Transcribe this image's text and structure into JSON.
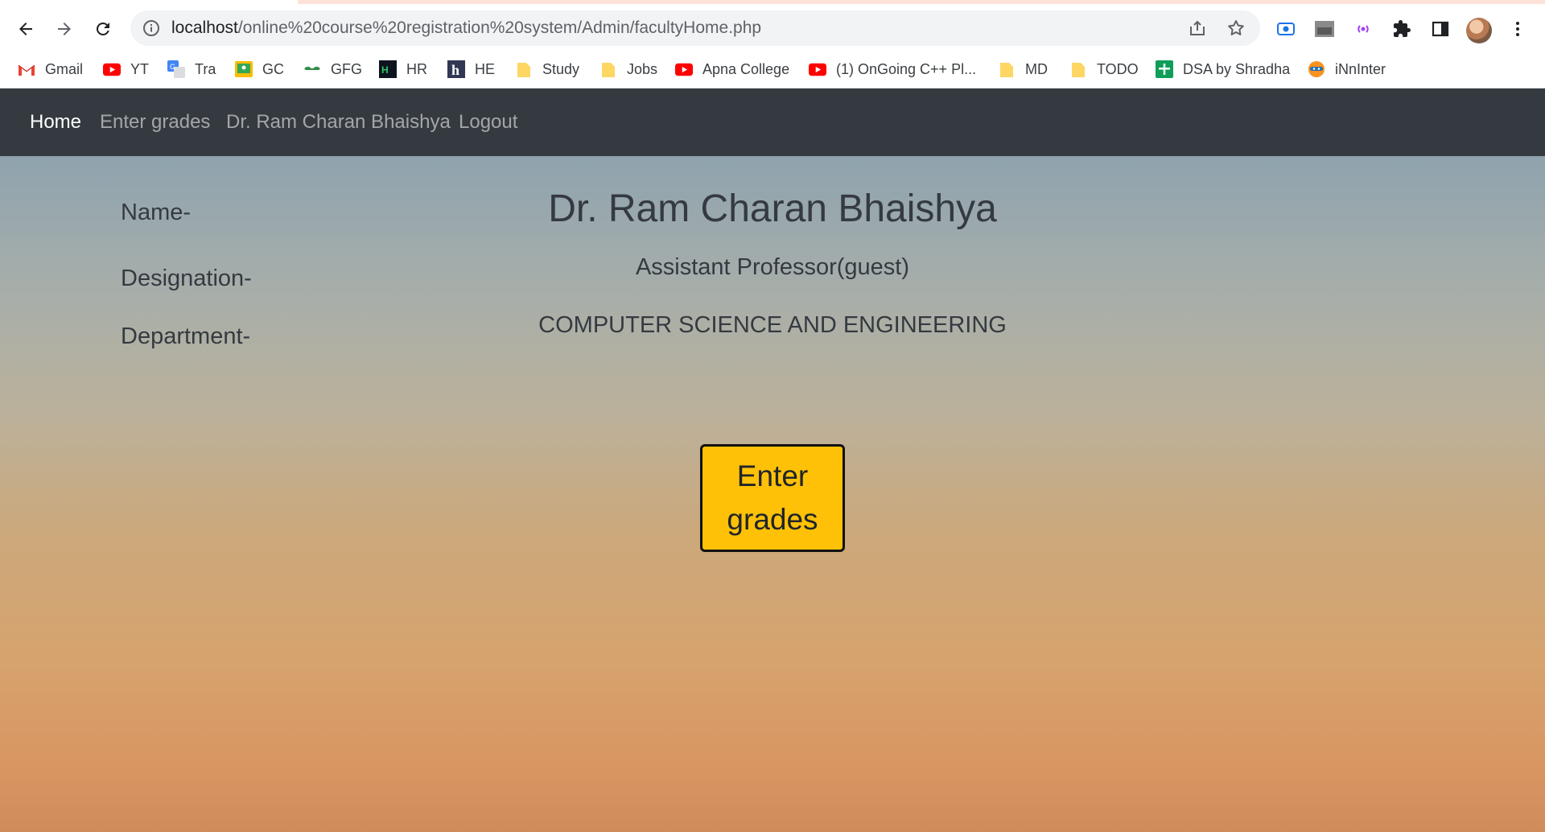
{
  "browser": {
    "url_host": "localhost",
    "url_path": "/online%20course%20registration%20system/Admin/facultyHome.php",
    "bookmarks": [
      {
        "label": "Gmail",
        "icon": "gmail-icon"
      },
      {
        "label": "YT",
        "icon": "youtube-icon"
      },
      {
        "label": "Tra",
        "icon": "translate-icon"
      },
      {
        "label": "GC",
        "icon": "classroom-icon"
      },
      {
        "label": "GFG",
        "icon": "gfg-icon"
      },
      {
        "label": "HR",
        "icon": "hackerrank-icon"
      },
      {
        "label": "HE",
        "icon": "hackerearth-icon"
      },
      {
        "label": "Study",
        "icon": "folder-icon"
      },
      {
        "label": "Jobs",
        "icon": "folder-icon"
      },
      {
        "label": "Apna College",
        "icon": "youtube-icon"
      },
      {
        "label": "(1) OnGoing C++ Pl...",
        "icon": "youtube-icon"
      },
      {
        "label": "MD",
        "icon": "folder-icon"
      },
      {
        "label": "TODO",
        "icon": "folder-icon"
      },
      {
        "label": "DSA by Shradha",
        "icon": "sheets-icon"
      },
      {
        "label": "iNnInter",
        "icon": "ninja-icon"
      }
    ]
  },
  "navbar": {
    "items": [
      {
        "label": "Home",
        "active": true
      },
      {
        "label": "Enter grades",
        "active": false
      },
      {
        "label": "Dr. Ram Charan Bhaishya",
        "active": false
      },
      {
        "label": "Logout",
        "active": false
      }
    ]
  },
  "profile": {
    "name_label": "Name-",
    "name": "Dr. Ram Charan Bhaishya",
    "designation_label": "Designation-",
    "designation": "Assistant Professor(guest)",
    "department_label": "Department-",
    "department": "COMPUTER SCIENCE AND ENGINEERING"
  },
  "actions": {
    "enter_grades_line1": "Enter",
    "enter_grades_line2": "grades"
  },
  "colors": {
    "navbar_bg": "#343a40",
    "button_bg": "#ffc107",
    "text_dark": "#343a40"
  }
}
